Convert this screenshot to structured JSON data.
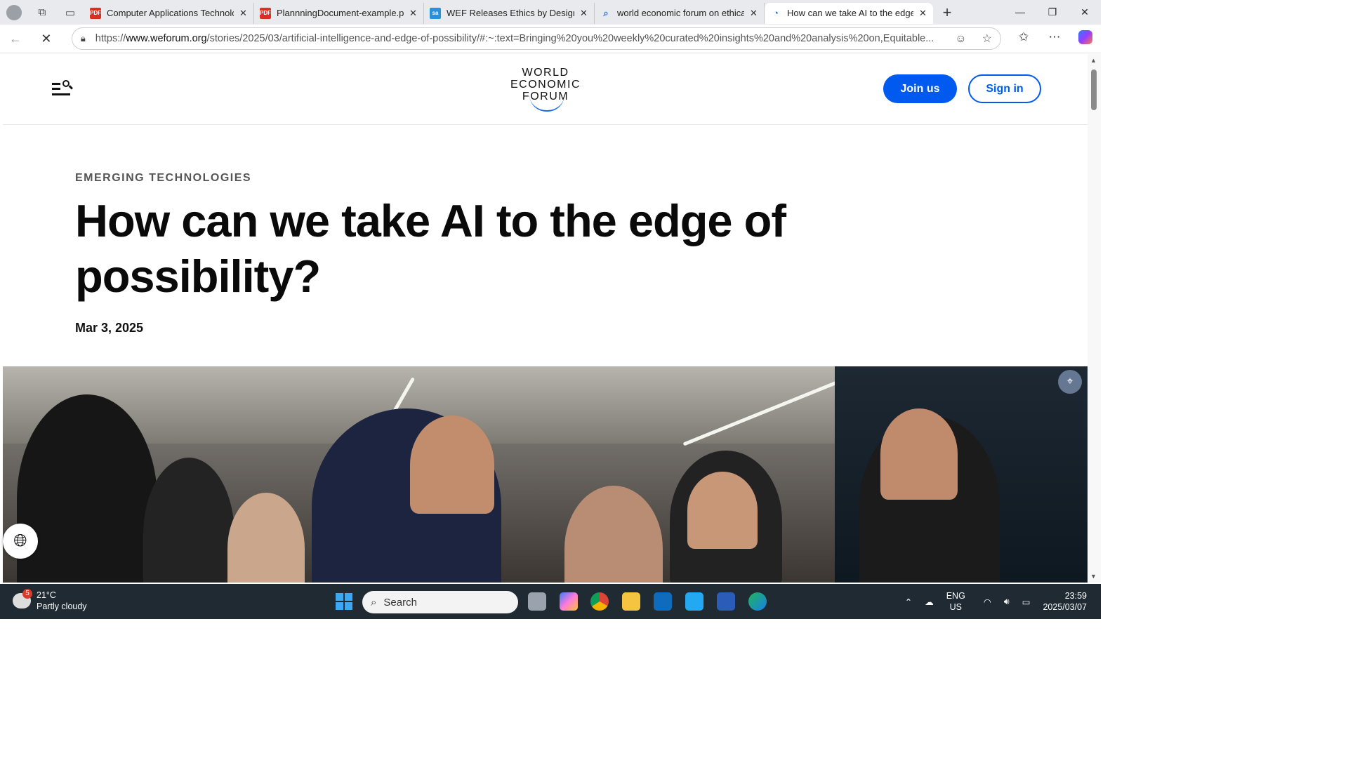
{
  "browser": {
    "tabs": [
      {
        "title": "Computer Applications Technolog",
        "favicon": "pdf-icon",
        "active": false
      },
      {
        "title": "PlannningDocument-example.pdf",
        "favicon": "pdf-icon",
        "active": false
      },
      {
        "title": "WEF Releases Ethics by Design Re",
        "favicon": "site-icon",
        "active": false
      },
      {
        "title": "world economic forum on ethical",
        "favicon": "search-icon",
        "active": false
      },
      {
        "title": "How can we take AI to the edge o",
        "favicon": "loading-icon",
        "active": true
      }
    ],
    "url_prefix": "https://",
    "url_host": "www.weforum.org",
    "url_path": "/stories/2025/03/artificial-intelligence-and-edge-of-possibility/#:~:text=Bringing%20you%20weekly%20curated%20insights%20and%20analysis%20on,Equitable..."
  },
  "site": {
    "logo_lines": [
      "WORLD",
      "ECONOMIC",
      "FORUM"
    ],
    "join_label": "Join us",
    "signin_label": "Sign in",
    "accent_color": "#005af0"
  },
  "article": {
    "kicker": "EMERGING TECHNOLOGIES",
    "title": "How can we take AI to the edge of possibility?",
    "date": "Mar 3, 2025"
  },
  "taskbar": {
    "weather_temp": "21°C",
    "weather_desc": "Partly cloudy",
    "weather_badge": "5",
    "search_placeholder": "Search",
    "lang_top": "ENG",
    "lang_bottom": "US",
    "time": "23:59",
    "date": "2025/03/07"
  }
}
